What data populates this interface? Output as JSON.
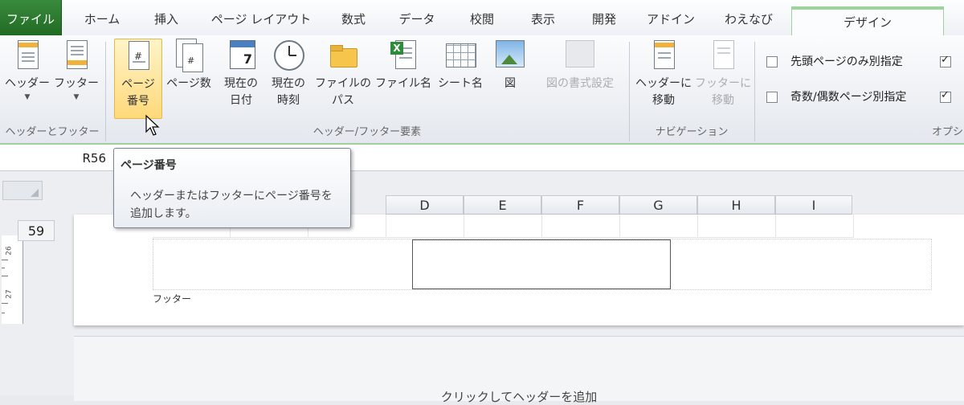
{
  "tabs": [
    {
      "label": "ファイル"
    },
    {
      "label": "ホーム"
    },
    {
      "label": "挿入"
    },
    {
      "label": "ページ レイアウト"
    },
    {
      "label": "数式"
    },
    {
      "label": "データ"
    },
    {
      "label": "校閲"
    },
    {
      "label": "表示"
    },
    {
      "label": "開発"
    },
    {
      "label": "アドイン"
    },
    {
      "label": "わえなび"
    },
    {
      "label": "デザイン"
    }
  ],
  "ribbon": {
    "group_hf": {
      "label": "ヘッダーとフッター",
      "header_btn": "ヘッダー",
      "footer_btn": "フッター"
    },
    "group_elements": {
      "label": "ヘッダー/フッター要素",
      "page_number": [
        "ページ",
        "番号"
      ],
      "page_count": "ページ数",
      "current_date": [
        "現在の",
        "日付"
      ],
      "current_time": [
        "現在の",
        "時刻"
      ],
      "file_path": [
        "ファイルの",
        "パス"
      ],
      "file_name": "ファイル名",
      "sheet_name": "シート名",
      "picture": "図",
      "format_picture": "図の書式設定"
    },
    "group_nav": {
      "label": "ナビゲーション",
      "goto_header": [
        "ヘッダーに",
        "移動"
      ],
      "goto_footer": [
        "フッターに",
        "移動"
      ]
    },
    "group_options": {
      "label": "オプシ",
      "first_page": "先頭ページのみ別指定",
      "odd_even": "奇数/偶数ページ別指定",
      "first_page_checked": false,
      "odd_even_checked": false
    }
  },
  "name_box": "R56",
  "columns": [
    "D",
    "E",
    "F",
    "G",
    "H",
    "I"
  ],
  "row_number": "59",
  "ruler_labels": [
    "26",
    "27"
  ],
  "footer_label": "フッター",
  "next_page_hint": "クリックしてヘッダーを追加",
  "tooltip": {
    "title": "ページ番号",
    "description": "ヘッダーまたはフッターにページ番号を追加します。"
  }
}
